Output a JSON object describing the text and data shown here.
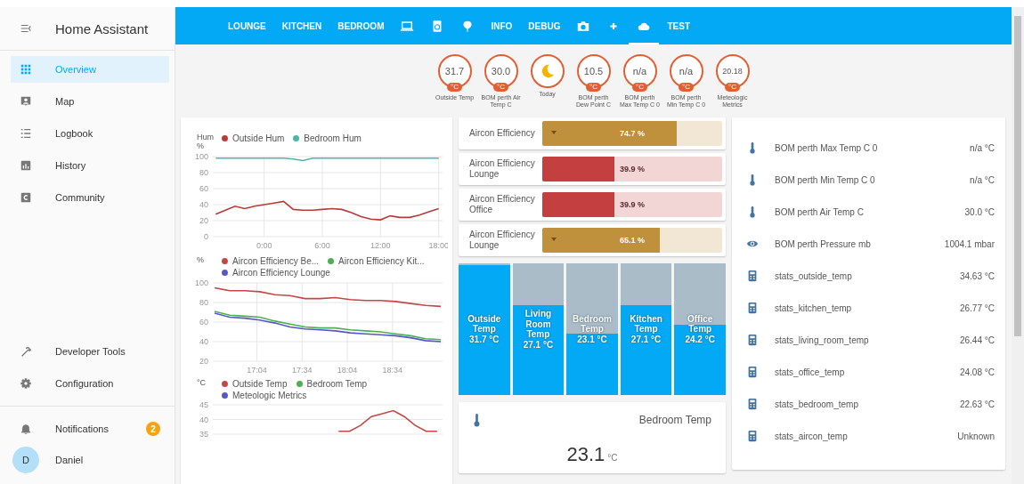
{
  "sidebar": {
    "title": "Home Assistant",
    "items": [
      {
        "label": "Overview",
        "kind": "grid",
        "selected": true
      },
      {
        "label": "Map",
        "kind": "card",
        "selected": false
      },
      {
        "label": "Logbook",
        "kind": "list",
        "selected": false
      },
      {
        "label": "History",
        "kind": "chart",
        "selected": false
      },
      {
        "label": "Community",
        "kind": "logo",
        "selected": false
      }
    ],
    "tools": [
      {
        "label": "Developer Tools",
        "kind": "hammer",
        "selected": false
      },
      {
        "label": "Configuration",
        "kind": "gear",
        "selected": false
      }
    ],
    "notifications": {
      "label": "Notifications",
      "count": "2"
    },
    "user": {
      "initial": "D",
      "name": "Daniel"
    }
  },
  "tabs": [
    {
      "kind": "text",
      "label": "LOUNGE",
      "selected": false
    },
    {
      "kind": "text",
      "label": "KITCHEN",
      "selected": false
    },
    {
      "kind": "text",
      "label": "BEDROOM",
      "selected": false
    },
    {
      "kind": "laptop",
      "selected": false
    },
    {
      "kind": "tablet",
      "selected": false
    },
    {
      "kind": "balloon",
      "selected": false
    },
    {
      "kind": "text",
      "label": "INFO",
      "selected": false
    },
    {
      "kind": "text",
      "label": "DEBUG",
      "selected": false
    },
    {
      "kind": "camera",
      "selected": false
    },
    {
      "kind": "plus",
      "selected": false
    },
    {
      "kind": "cloud",
      "selected": true
    },
    {
      "kind": "text",
      "label": "TEST",
      "selected": false
    }
  ],
  "badges": [
    {
      "kind": "value",
      "value": "31.7",
      "unit": "°C",
      "label": "Outside Temp"
    },
    {
      "kind": "value",
      "value": "30.0",
      "unit": "°C",
      "label": "BOM perth Air Temp C"
    },
    {
      "kind": "moon",
      "label": "Today"
    },
    {
      "kind": "value",
      "value": "10.5",
      "unit": "°C",
      "label": "BOM perth Dew Point C"
    },
    {
      "kind": "value",
      "value": "n/a",
      "unit": "°C",
      "label": "BOM perth Max Temp C 0"
    },
    {
      "kind": "value",
      "value": "n/a",
      "unit": "°C",
      "label": "BOM perth Min Temp C 0"
    },
    {
      "kind": "value",
      "value": "20.18",
      "unit": "°C",
      "label": "Meteologic Metrics"
    }
  ],
  "history_card": {
    "charts": [
      {
        "chart_data": {
          "type": "line",
          "ylabel": "Hum %",
          "grid": true,
          "x": [
            -5,
            -4,
            -3,
            -2,
            -1,
            0,
            1,
            2,
            3,
            4,
            5,
            6,
            7,
            8,
            9,
            10,
            11,
            12,
            13,
            14,
            15,
            16,
            17,
            18
          ],
          "xlim": [
            -5.3,
            18.4
          ],
          "ylim": [
            0,
            100
          ],
          "yticks": [
            0,
            20,
            40,
            60,
            80,
            100
          ],
          "xticks": [
            {
              "value": 0,
              "label": "0:00"
            },
            {
              "value": 6,
              "label": "6:00"
            },
            {
              "value": 12,
              "label": "12:00"
            },
            {
              "value": 18,
              "label": "18:00"
            }
          ],
          "series": [
            {
              "name": "Outside Hum",
              "color": "#b83a3a",
              "values": [
                28,
                33,
                38,
                35,
                38,
                40,
                42,
                44,
                34,
                33,
                33,
                34,
                35,
                34,
                30,
                25,
                22,
                21,
                26,
                24,
                24,
                27,
                31,
                35
              ]
            },
            {
              "name": "Bedroom Hum",
              "color": "#4db6ac",
              "values": [
                98,
                98,
                98,
                98,
                98,
                98,
                98,
                98,
                97,
                95,
                98,
                98,
                98,
                98,
                98,
                98,
                98,
                98,
                98,
                98,
                98,
                98,
                98,
                98
              ]
            }
          ]
        }
      },
      {
        "chart_data": {
          "type": "line",
          "ylabel": "%",
          "grid": true,
          "x": [
            16.6,
            16.767,
            16.933,
            17.1,
            17.267,
            17.433,
            17.6,
            17.767,
            17.933,
            18.1,
            18.267,
            18.433,
            18.6,
            18.767,
            18.933,
            19.1
          ],
          "xlim": [
            16.58,
            19.12
          ],
          "ylim": [
            20,
            100
          ],
          "yticks": [
            20,
            40,
            60,
            80,
            100
          ],
          "xticks": [
            {
              "value": 17.067,
              "label": "17:04"
            },
            {
              "value": 17.567,
              "label": "17:34"
            },
            {
              "value": 18.067,
              "label": "18:04"
            },
            {
              "value": 18.567,
              "label": "18:34"
            }
          ],
          "series": [
            {
              "name": "Aircon Efficiency Be...",
              "color": "#c24848",
              "values": [
                95,
                92,
                92,
                91,
                88,
                87,
                84,
                84,
                85,
                83,
                82,
                82,
                81,
                79,
                77,
                76
              ]
            },
            {
              "name": "Aircon Efficiency Kit...",
              "color": "#4caf50",
              "values": [
                71,
                67,
                66,
                65,
                61,
                58,
                55,
                54,
                54,
                52,
                51,
                50,
                48,
                46,
                43,
                42
              ]
            },
            {
              "name": "Aircon Efficiency Lounge",
              "color": "#5558c4",
              "values": [
                69,
                65,
                64,
                62,
                59,
                55,
                53,
                52,
                51,
                49,
                48,
                47,
                46,
                44,
                41,
                40
              ]
            }
          ]
        }
      },
      {
        "chart_data": {
          "type": "line",
          "ylabel": "°C",
          "grid": true,
          "categories": [
            null,
            null,
            null,
            null,
            null,
            null,
            null,
            null,
            null,
            null,
            null,
            null,
            null,
            null,
            null,
            null,
            null,
            null,
            null,
            null,
            null
          ],
          "ylim": [
            35,
            45
          ],
          "yticks": [
            35,
            40,
            45
          ],
          "series": [
            {
              "name": "Outside Temp",
              "color": "#c24848",
              "values": [
                null,
                null,
                null,
                null,
                null,
                null,
                null,
                null,
                null,
                null,
                null,
                36,
                36,
                38,
                41,
                42,
                43,
                41,
                38,
                36,
                36
              ]
            },
            {
              "name": "Bedroom Temp",
              "color": "#4caf50",
              "values": [
                null,
                null,
                null,
                null,
                null,
                null,
                null,
                null,
                null,
                null,
                null,
                null,
                null,
                null,
                null,
                null,
                null,
                null,
                null,
                null,
                null
              ]
            },
            {
              "name": "Meteologic Metrics",
              "color": "#5558c4",
              "values": [
                null,
                null,
                null,
                null,
                null,
                null,
                null,
                null,
                null,
                null,
                null,
                null,
                null,
                null,
                null,
                null,
                null,
                null,
                null,
                null,
                null
              ]
            }
          ]
        }
      }
    ]
  },
  "bar_rows": [
    {
      "label": "Aircon Efficiency",
      "value": "74.7 %",
      "level": 0.747,
      "color": "#c0913c",
      "trend_marker": true
    },
    {
      "label": "Aircon Efficiency Lounge",
      "value": "39.9 %",
      "level": 0.399,
      "color": "#c43f3f",
      "trend_marker": false
    },
    {
      "label": "Aircon Efficiency Office",
      "value": "39.9 %",
      "level": 0.399,
      "color": "#c43f3f",
      "trend_marker": false
    },
    {
      "label": "Aircon Efficiency Lounge",
      "value": "65.1 %",
      "level": 0.651,
      "color": "#c0913c",
      "trend_marker": true
    }
  ],
  "temp_tiles": [
    {
      "label": "Outside Temp",
      "value": "31.7 °C",
      "level": 1
    },
    {
      "label": "Living Room Temp",
      "value": "27.1 °C",
      "level": 0.69
    },
    {
      "label": "Bedroom Temp",
      "value": "23.1 °C",
      "level": 0.47
    },
    {
      "label": "Kitchen Temp",
      "value": "27.1 °C",
      "level": 0.69
    },
    {
      "label": "Office Temp",
      "value": "24.2 °C",
      "level": 0.54
    }
  ],
  "sensor_card": {
    "name": "Bedroom Temp",
    "value": "23.1",
    "unit": "°C"
  },
  "entities": [
    {
      "kind": "thermometer",
      "name": "BOM perth Max Temp C 0",
      "state": "n/a °C"
    },
    {
      "kind": "thermometer",
      "name": "BOM perth Min Temp C 0",
      "state": "n/a °C"
    },
    {
      "kind": "thermometer",
      "name": "BOM perth Air Temp C",
      "state": "30.0 °C"
    },
    {
      "kind": "eye",
      "name": "BOM perth Pressure mb",
      "state": "1004.1 mbar"
    },
    {
      "kind": "calculator",
      "name": "stats_outside_temp",
      "state": "34.63 °C"
    },
    {
      "kind": "calculator",
      "name": "stats_kitchen_temp",
      "state": "26.77 °C"
    },
    {
      "kind": "calculator",
      "name": "stats_living_room_temp",
      "state": "26.44 °C"
    },
    {
      "kind": "calculator",
      "name": "stats_office_temp",
      "state": "24.08 °C"
    },
    {
      "kind": "calculator",
      "name": "stats_bedroom_temp",
      "state": "22.63 °C"
    },
    {
      "kind": "calculator",
      "name": "stats_aircon_temp",
      "state": "Unknown"
    }
  ]
}
